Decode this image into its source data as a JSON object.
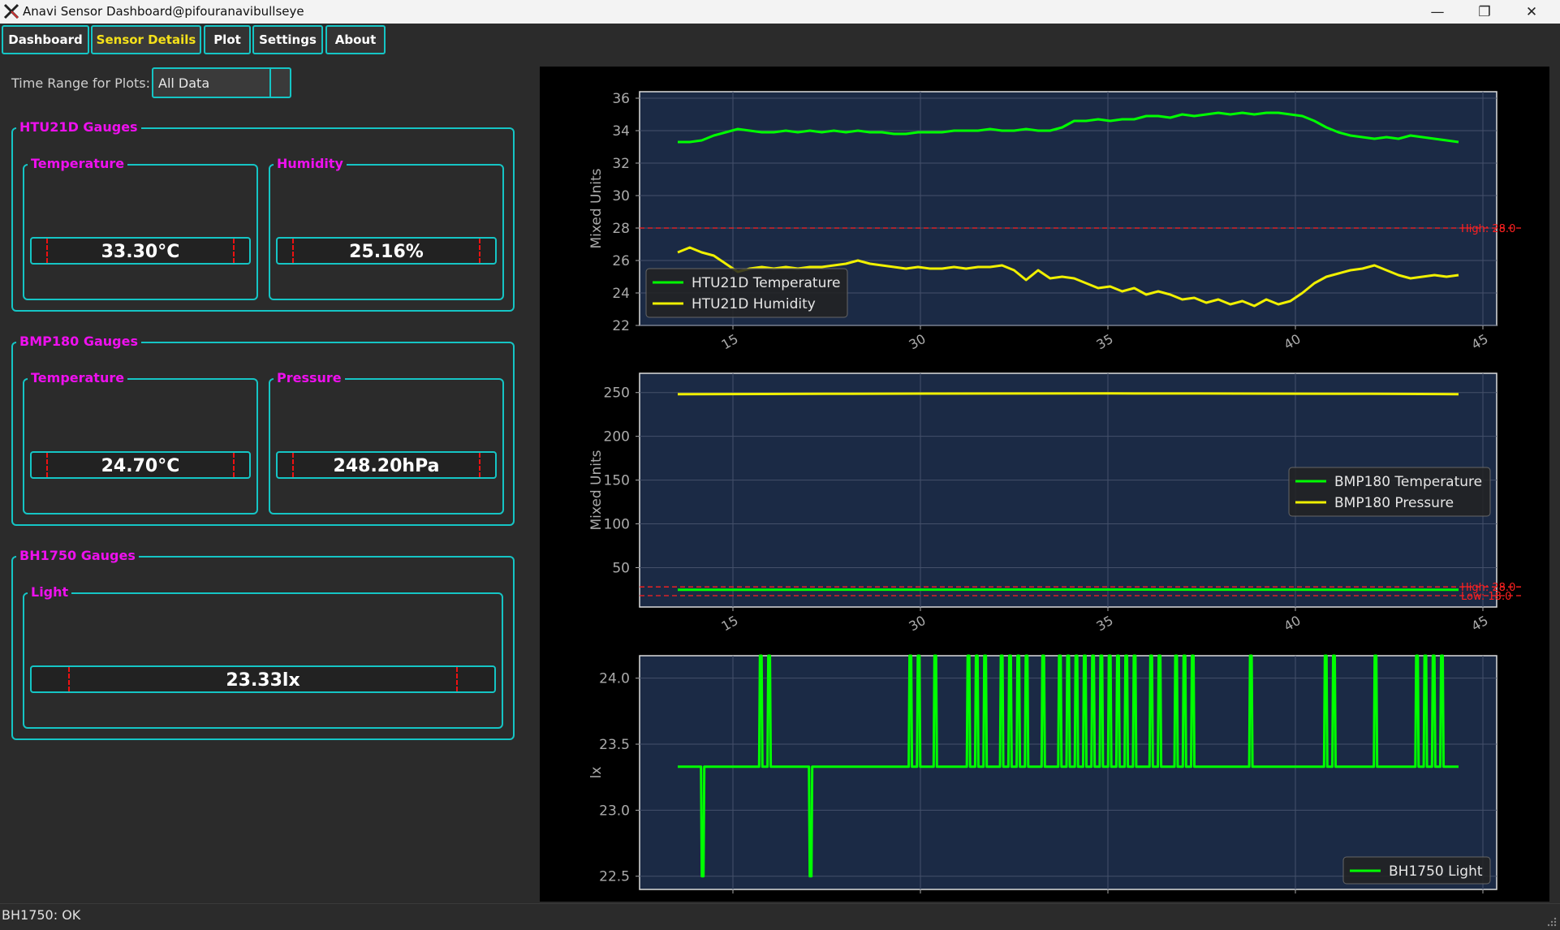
{
  "window": {
    "title": "Anavi Sensor Dashboard@pifouranavibullseye",
    "minimize_icon": "minimize-icon",
    "restore_icon": "restore-icon",
    "close_icon": "close-icon"
  },
  "tabs": [
    {
      "label": "Dashboard"
    },
    {
      "label": "Sensor Details",
      "active": true
    },
    {
      "label": "Plot"
    },
    {
      "label": "Settings"
    },
    {
      "label": "About"
    }
  ],
  "time_range": {
    "label": "Time Range for Plots:",
    "value": "All Data"
  },
  "groups": {
    "htu21d": {
      "title": "HTU21D Gauges",
      "temperature": {
        "title": "Temperature",
        "value": "33.30°C"
      },
      "humidity": {
        "title": "Humidity",
        "value": "25.16%"
      }
    },
    "bmp180": {
      "title": "BMP180 Gauges",
      "temperature": {
        "title": "Temperature",
        "value": "24.70°C"
      },
      "pressure": {
        "title": "Pressure",
        "value": "248.20hPa"
      }
    },
    "bh1750": {
      "title": "BH1750 Gauges",
      "light": {
        "title": "Light",
        "value": "23.33lx"
      }
    }
  },
  "colors": {
    "accent": "#15c5c5",
    "group_title": "#ee10ee",
    "active_tab": "#f5e11a",
    "threshold": "#ff2020",
    "series_green": "#00ff00",
    "series_yellow": "#f0f000",
    "plot_bg": "#1b2a45"
  },
  "chart_data": [
    {
      "type": "line",
      "ylabel": "Mixed Units",
      "ylim": [
        22,
        36.4
      ],
      "yticks": [
        22,
        24,
        26,
        28,
        30,
        32,
        34,
        36
      ],
      "xticks": [
        "15",
        "30",
        "35",
        "40",
        "45"
      ],
      "grid": true,
      "legend_position": "lower-left",
      "threshold_labels": [
        "High: 28.0"
      ],
      "thresholds": [
        28
      ],
      "series": [
        {
          "name": "HTU21D Temperature",
          "color": "#00ff00",
          "values": [
            33.3,
            33.3,
            33.4,
            33.7,
            33.9,
            34.1,
            34.0,
            33.9,
            33.9,
            34.0,
            33.9,
            34.0,
            33.9,
            34.0,
            33.9,
            34.0,
            33.9,
            33.9,
            33.8,
            33.8,
            33.9,
            33.9,
            33.9,
            34.0,
            34.0,
            34.0,
            34.1,
            34.0,
            34.0,
            34.1,
            34.0,
            34.0,
            34.2,
            34.6,
            34.6,
            34.7,
            34.6,
            34.7,
            34.7,
            34.9,
            34.9,
            34.8,
            35.0,
            34.9,
            35.0,
            35.1,
            35.0,
            35.1,
            35.0,
            35.1,
            35.1,
            35.0,
            34.9,
            34.6,
            34.2,
            33.9,
            33.7,
            33.6,
            33.5,
            33.6,
            33.5,
            33.7,
            33.6,
            33.5,
            33.4,
            33.3
          ]
        },
        {
          "name": "HTU21D Humidity",
          "color": "#f0f000",
          "values": [
            26.5,
            26.8,
            26.5,
            26.3,
            25.8,
            25.3,
            25.5,
            25.6,
            25.5,
            25.6,
            25.5,
            25.6,
            25.6,
            25.7,
            25.8,
            26.0,
            25.8,
            25.7,
            25.6,
            25.5,
            25.6,
            25.5,
            25.5,
            25.6,
            25.5,
            25.6,
            25.6,
            25.7,
            25.4,
            24.8,
            25.4,
            24.9,
            25.0,
            24.9,
            24.6,
            24.3,
            24.4,
            24.1,
            24.3,
            23.9,
            24.1,
            23.9,
            23.6,
            23.7,
            23.4,
            23.6,
            23.3,
            23.5,
            23.2,
            23.6,
            23.3,
            23.5,
            24.0,
            24.6,
            25.0,
            25.2,
            25.4,
            25.5,
            25.7,
            25.4,
            25.1,
            24.9,
            25.0,
            25.1,
            25.0,
            25.1
          ]
        }
      ]
    },
    {
      "type": "line",
      "ylabel": "Mixed Units",
      "ylim": [
        5,
        272
      ],
      "yticks": [
        50,
        100,
        150,
        200,
        250
      ],
      "xticks": [
        "15",
        "30",
        "35",
        "40",
        "45"
      ],
      "grid": true,
      "legend_position": "center-right",
      "threshold_labels": [
        "High: 28.0",
        "Low: 18.0"
      ],
      "thresholds": [
        28,
        18
      ],
      "series": [
        {
          "name": "BMP180 Temperature",
          "color": "#00ff00",
          "values": [
            24.7,
            24.7,
            24.8,
            24.8,
            24.9,
            24.9,
            24.8,
            24.8,
            24.7,
            24.7
          ]
        },
        {
          "name": "BMP180 Pressure",
          "color": "#f0f000",
          "values": [
            248.2,
            248.4,
            248.6,
            248.8,
            248.9,
            249.0,
            248.9,
            248.7,
            248.5,
            248.2
          ]
        }
      ]
    },
    {
      "type": "line",
      "ylabel": "lx",
      "ylim": [
        22.4,
        24.17
      ],
      "yticks": [
        22.5,
        23.0,
        23.5,
        24.0
      ],
      "grid": true,
      "legend_position": "lower-right",
      "series": [
        {
          "name": "BH1750 Light",
          "color": "#00ff00",
          "base": 23.33,
          "events": [
            [
              3,
              22.5
            ],
            [
              10,
              24.17
            ],
            [
              11,
              24.17
            ],
            [
              16,
              22.5
            ],
            [
              28,
              24.17
            ],
            [
              29,
              24.17
            ],
            [
              31,
              24.17
            ],
            [
              35,
              24.17
            ],
            [
              36,
              24.17
            ],
            [
              37,
              24.17
            ],
            [
              39,
              24.17
            ],
            [
              40,
              24.17
            ],
            [
              41,
              24.17
            ],
            [
              42,
              24.17
            ],
            [
              44,
              24.17
            ],
            [
              46,
              24.17
            ],
            [
              47,
              24.17
            ],
            [
              48,
              24.17
            ],
            [
              49,
              24.17
            ],
            [
              50,
              24.17
            ],
            [
              51,
              24.17
            ],
            [
              52,
              24.17
            ],
            [
              53,
              24.17
            ],
            [
              54,
              24.17
            ],
            [
              55,
              24.17
            ],
            [
              57,
              24.17
            ],
            [
              58,
              24.17
            ],
            [
              60,
              24.17
            ],
            [
              61,
              24.17
            ],
            [
              62,
              24.17
            ],
            [
              69,
              24.17
            ],
            [
              78,
              24.17
            ],
            [
              79,
              24.17
            ],
            [
              84,
              24.17
            ],
            [
              89,
              24.17
            ],
            [
              90,
              24.17
            ],
            [
              91,
              24.17
            ],
            [
              92,
              24.17
            ]
          ],
          "points": 95
        }
      ]
    }
  ],
  "status": {
    "text": "BH1750: OK"
  }
}
